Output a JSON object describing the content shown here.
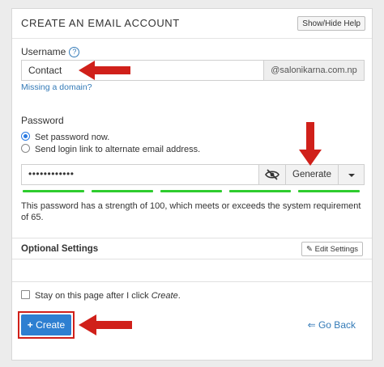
{
  "panel": {
    "title": "CREATE AN EMAIL ACCOUNT",
    "help_button": "Show/Hide Help"
  },
  "username": {
    "label": "Username",
    "help_icon": "question-circle-icon",
    "value": "Contact",
    "domain": "@salonikarna.com.np",
    "missing_domain_link": "Missing a domain?"
  },
  "password": {
    "label": "Password",
    "options": [
      {
        "label": "Set password now.",
        "checked": true
      },
      {
        "label": "Send login link to alternate email address.",
        "checked": false
      }
    ],
    "value": "••••••••••••",
    "eye_icon": "eye-slash-icon",
    "generate_label": "Generate",
    "strength_segments": 5,
    "strength_color": "#2ecc2e",
    "strength_message": "This password has a strength of 100, which meets or exceeds the system requirement of 65."
  },
  "optional": {
    "title": "Optional Settings",
    "edit_button": "Edit Settings",
    "edit_icon": "pencil-icon"
  },
  "footer": {
    "stay_prefix": "Stay on this page after I click ",
    "stay_emphasis": "Create",
    "stay_suffix": ".",
    "create_label": "Create",
    "create_icon": "plus-icon",
    "go_back_label": "Go Back",
    "go_back_icon": "arrow-left-icon"
  },
  "colors": {
    "primary": "#2e7fd1",
    "link": "#337ab7",
    "annotation": "#d0201a"
  },
  "annotations": {
    "arrow_icon": "red-arrow-icon"
  }
}
